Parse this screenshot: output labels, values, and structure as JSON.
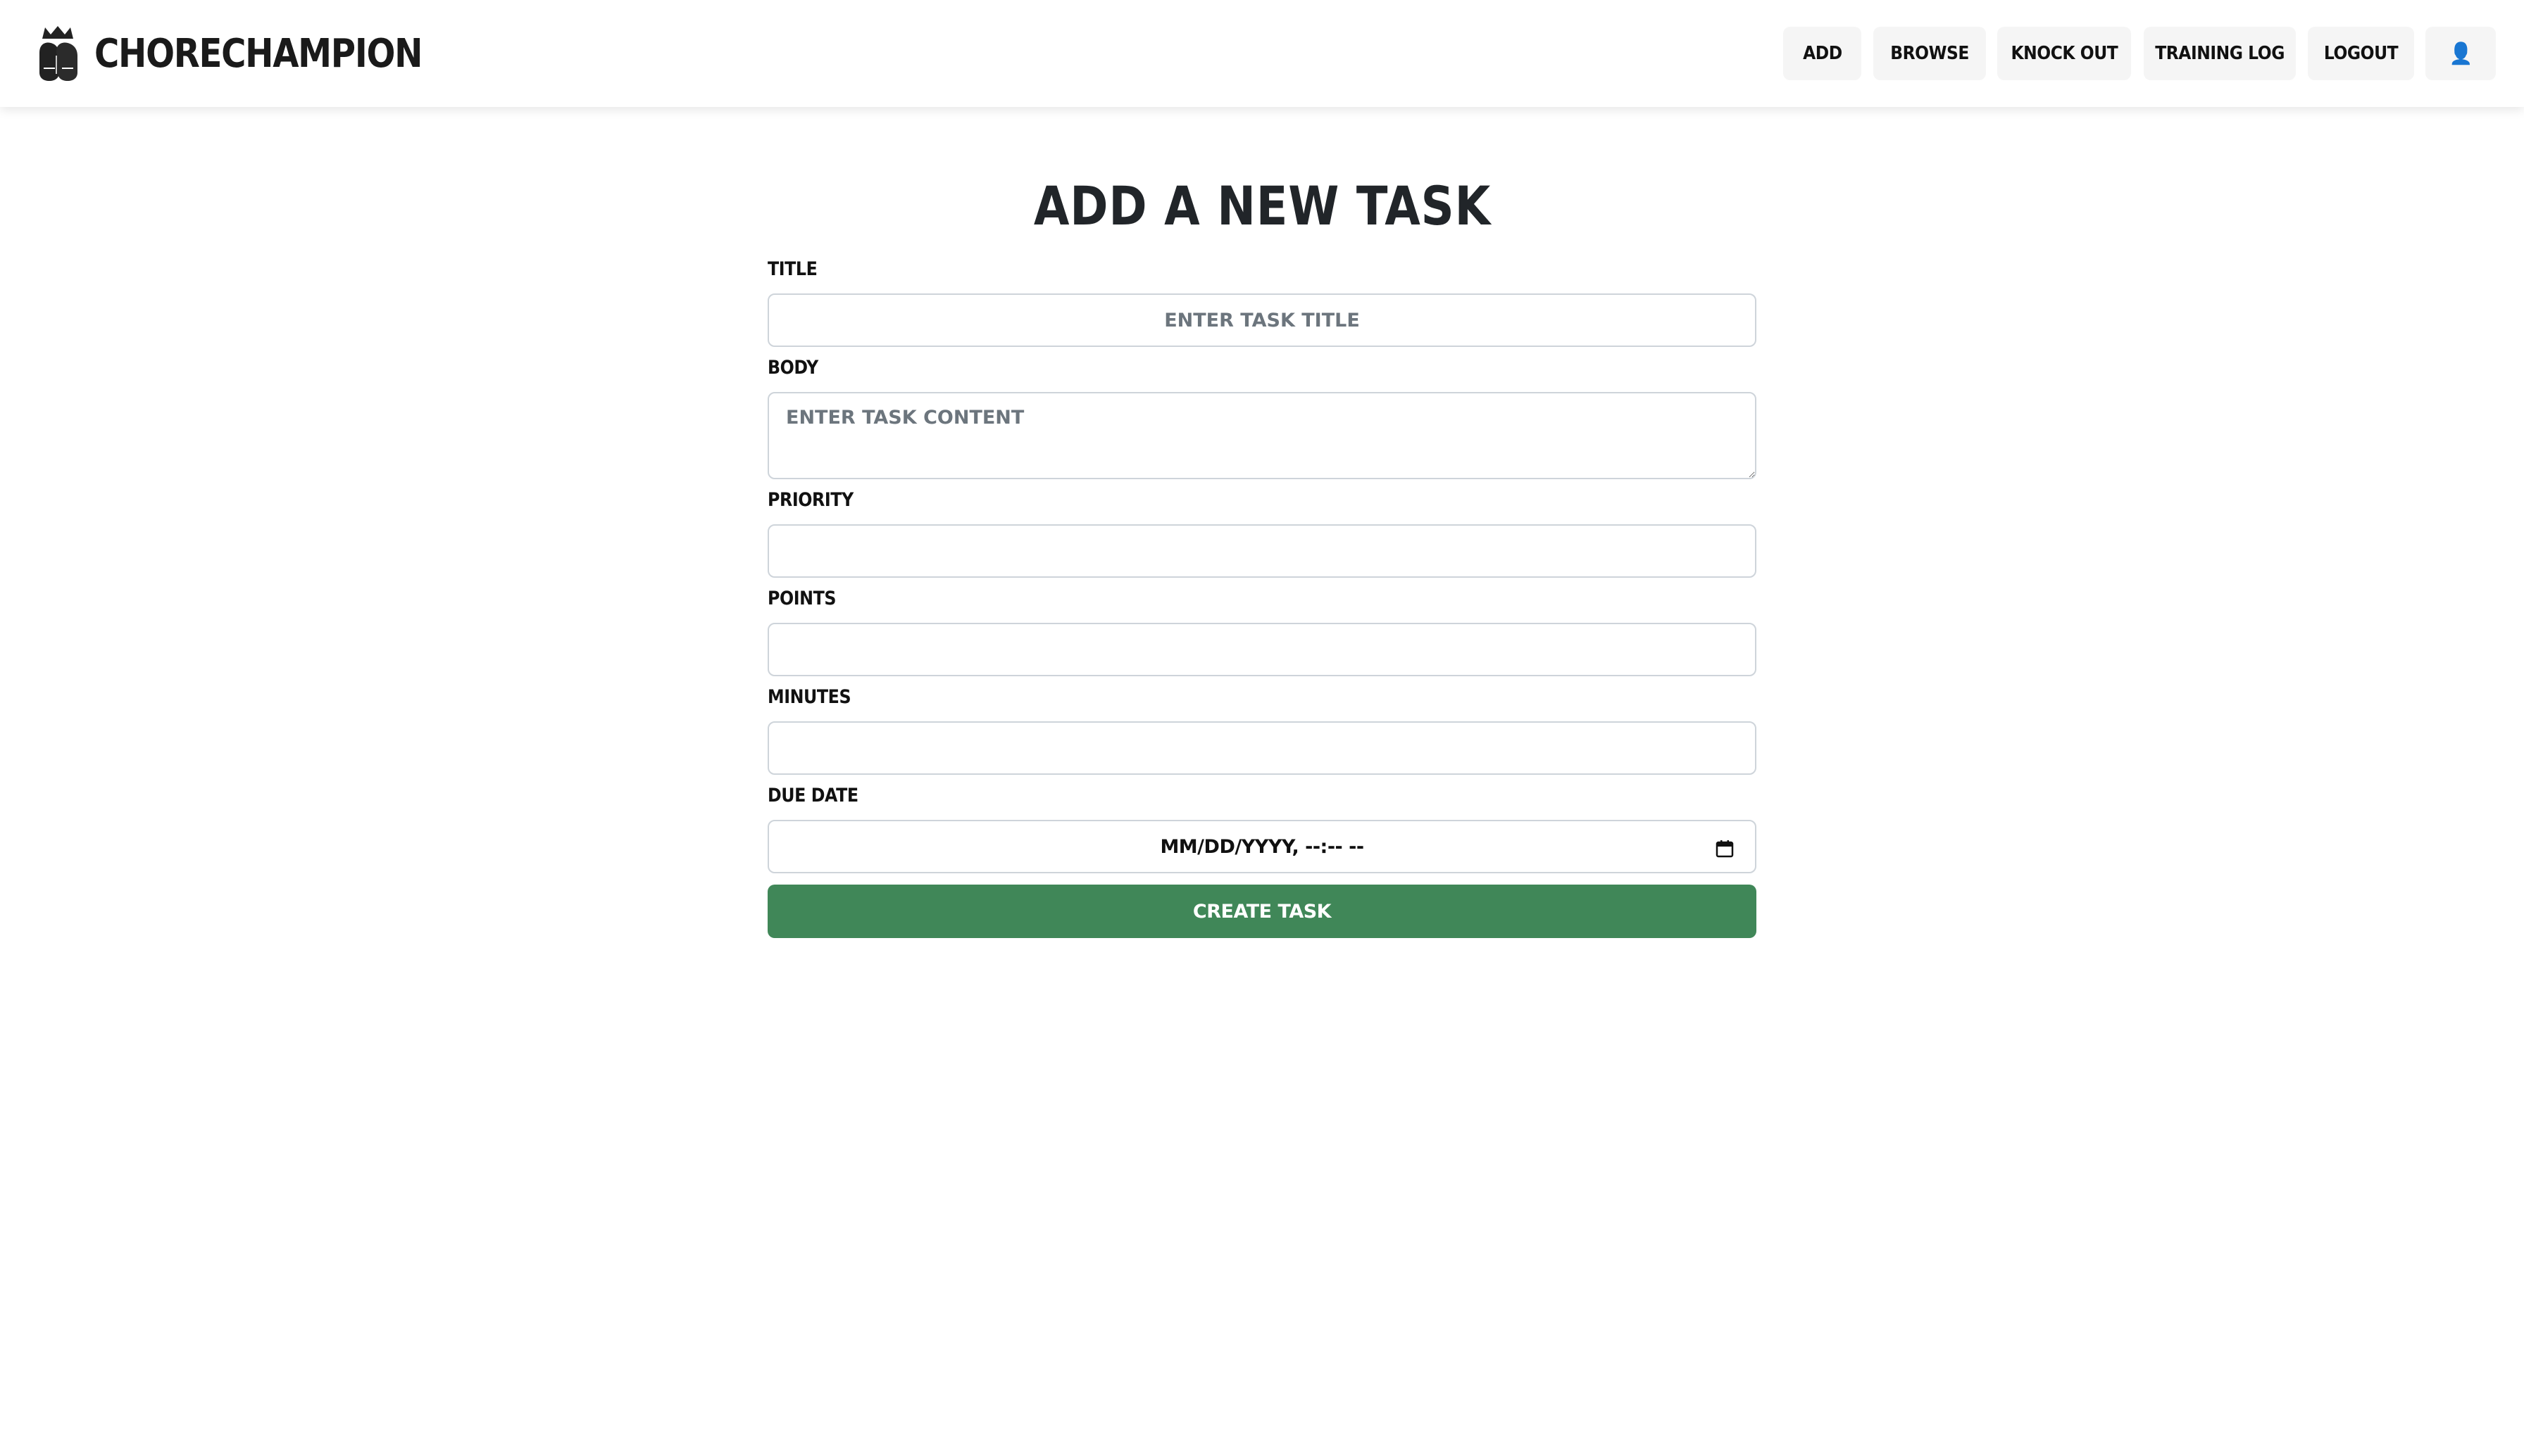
{
  "navbar": {
    "brand": "CHORECHAMPION",
    "brand_logo_icon": "boxing-gloves-crown-icon",
    "items": [
      {
        "label": "ADD"
      },
      {
        "label": "BROWSE"
      },
      {
        "label": "KNOCK OUT"
      },
      {
        "label": "TRAINING LOG"
      },
      {
        "label": "LOGOUT"
      }
    ],
    "profile": {
      "glyph": "👤",
      "icon": "user-icon"
    }
  },
  "form": {
    "heading": "ADD A NEW TASK",
    "title": {
      "label": "TITLE",
      "placeholder": "ENTER TASK TITLE",
      "value": ""
    },
    "body": {
      "label": "BODY",
      "placeholder": "ENTER TASK CONTENT",
      "value": ""
    },
    "priority": {
      "label": "PRIORITY",
      "value": ""
    },
    "points": {
      "label": "POINTS",
      "value": ""
    },
    "minutes": {
      "label": "MINUTES",
      "value": ""
    },
    "due_date": {
      "label": "DUE DATE",
      "display": "MM/DD/YYYY, --:-- --",
      "icon": "calendar-icon"
    },
    "submit_label": "CREATE TASK"
  },
  "colors": {
    "submit_button": "#408758",
    "nav_button_bg": "#f5f5f5",
    "field_border": "#ced4da",
    "placeholder": "#6c757d"
  }
}
